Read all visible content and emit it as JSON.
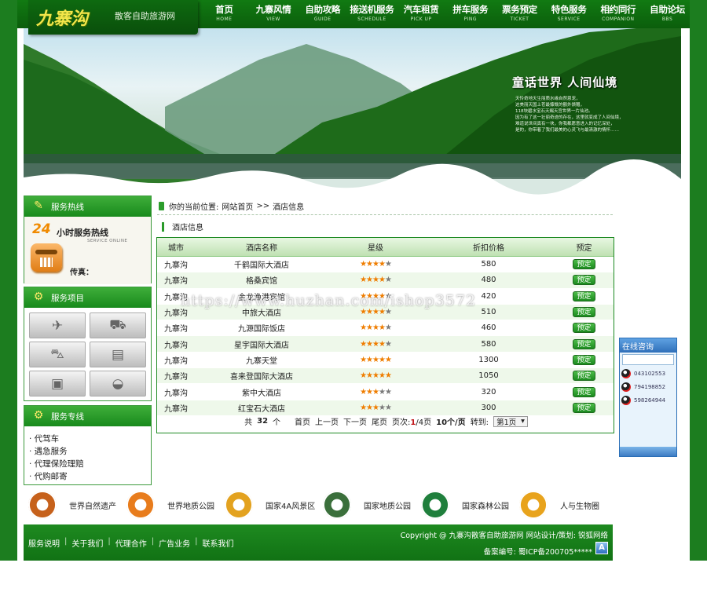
{
  "site": {
    "logo_main": "九寨沟",
    "logo_sub": "散客自助旅游网"
  },
  "nav": [
    {
      "cn": "首页",
      "en": "HOME"
    },
    {
      "cn": "九寨风情",
      "en": "VIEW"
    },
    {
      "cn": "自助攻略",
      "en": "GUIDE"
    },
    {
      "cn": "接送机服务",
      "en": "SCHEDULE"
    },
    {
      "cn": "汽车租赁",
      "en": "PICK UP"
    },
    {
      "cn": "拼车服务",
      "en": "PING"
    },
    {
      "cn": "票务预定",
      "en": "TICKET"
    },
    {
      "cn": "特色服务",
      "en": "SERVICE"
    },
    {
      "cn": "相约同行",
      "en": "COMPANION"
    },
    {
      "cn": "自助论坛",
      "en": "BBS"
    }
  ],
  "banner": {
    "title": "童话世界  人间仙境",
    "lines": [
      "天怜奇地天生丽质水缘自然恩宠，",
      "这美丽天国上苍最慷慨的额外馈赠，",
      "118块碧水宝石天赐天宫世界一片仙池。",
      "因为有了这一壮丽奇迹的存在，这里就变成了人间仙境，",
      "难道说世间真有一块，你我都愿意进入的记忆深处，",
      "是的，你带着了我们最美的心灵飞与最清澈的情怀……"
    ]
  },
  "sidebar": {
    "hotline": {
      "title": "服务热线",
      "big24": "24",
      "text": "小时服务热线",
      "en": "SERVICE ONLINE",
      "fax": "传真："
    },
    "projects": {
      "title": "服务项目"
    },
    "lines": {
      "title": "服务专线",
      "items": [
        "· 代驾车",
        "· 遇急服务",
        "· 代理保险理赔",
        "· 代购邮寄"
      ]
    }
  },
  "breadcrumb": {
    "prefix": "你的当前位置:",
    "home": "网站首页",
    "sep": ">>",
    "current": "酒店信息"
  },
  "section_title": "酒店信息",
  "table": {
    "headers": [
      "城市",
      "酒店名称",
      "星级",
      "折扣价格",
      "预定"
    ],
    "rows": [
      {
        "city": "九寨沟",
        "name": "千鹤国际大酒店",
        "stars": 4,
        "price": "580",
        "book": "预定"
      },
      {
        "city": "九寨沟",
        "name": "格桑宾馆",
        "stars": 4,
        "price": "480",
        "book": "预定"
      },
      {
        "city": "九寨沟",
        "name": "金龙渔港宾馆",
        "stars": 4,
        "price": "420",
        "book": "预定"
      },
      {
        "city": "九寨沟",
        "name": "中旅大酒店",
        "stars": 4,
        "price": "510",
        "book": "预定"
      },
      {
        "city": "九寨沟",
        "name": "九源国际饭店",
        "stars": 4,
        "price": "460",
        "book": "预定"
      },
      {
        "city": "九寨沟",
        "name": "星宇国际大酒店",
        "stars": 4,
        "price": "580",
        "book": "预定"
      },
      {
        "city": "九寨沟",
        "name": "九寨天堂",
        "stars": 5,
        "price": "1300",
        "book": "预定"
      },
      {
        "city": "九寨沟",
        "name": "喜来登国际大酒店",
        "stars": 5,
        "price": "1050",
        "book": "预定"
      },
      {
        "city": "九寨沟",
        "name": "紫中大酒店",
        "stars": 3,
        "price": "320",
        "book": "预定"
      },
      {
        "city": "九寨沟",
        "name": "红宝石大酒店",
        "stars": 3,
        "price": "300",
        "book": "预定"
      }
    ]
  },
  "pager": {
    "total_pre": "共",
    "total": "32",
    "total_post": "个",
    "first": "首页",
    "prev": "上一页",
    "next": "下一页",
    "last": "尾页",
    "page_label": "页次:",
    "page_cur": "1",
    "page_total": "/4页",
    "per_page": "10个/页",
    "goto": "转到:",
    "select_value": "第1页"
  },
  "online": {
    "title": "在线咨询",
    "qq": [
      "043102553",
      "794198852",
      "598264944"
    ]
  },
  "logos": [
    {
      "text": "世界自然遗产",
      "color": "#c6611b"
    },
    {
      "text": "世界地质公园",
      "color": "#e87c1c"
    },
    {
      "text": "国家4A风景区",
      "color": "#e3a21f"
    },
    {
      "text": "国家地质公园",
      "color": "#3a6f3b"
    },
    {
      "text": "国家森林公园",
      "color": "#1f7f3c"
    },
    {
      "text": "人与生物圈",
      "color": "#e8a31c"
    }
  ],
  "footer": {
    "links": [
      "服务说明",
      "关于我们",
      "代理合作",
      "广告业务",
      "联系我们"
    ],
    "copyright": "Copyright @ 九寨沟散客自助旅游网 网站设计/策划: 锐狐网络",
    "icp": "备案编号: 蜀ICP备200705*****",
    "badge": "A"
  },
  "watermark": "https://www.huzhan.com/ishop3572"
}
